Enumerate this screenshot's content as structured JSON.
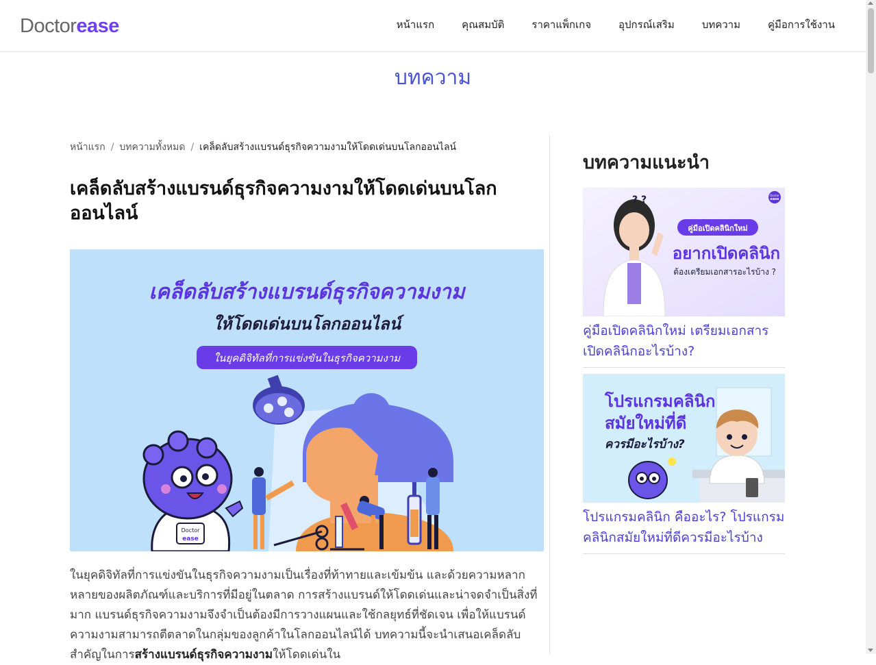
{
  "brand": {
    "logo_part1": "Doctor",
    "logo_part2": "ease"
  },
  "nav": [
    {
      "label": "หน้าแรก"
    },
    {
      "label": "คุณสมบัติ"
    },
    {
      "label": "ราคาแพ็กเกจ"
    },
    {
      "label": "อุปกรณ์เสริม"
    },
    {
      "label": "บทความ"
    },
    {
      "label": "คู่มือการใช้งาน"
    }
  ],
  "page_heading": "บทความ",
  "breadcrumb": {
    "home": "หน้าแรก",
    "all": "บทความทั้งหมด",
    "current": "เคล็ดลับสร้างแบรนด์ธุรกิจความงามให้โดดเด่นบนโลกออนไลน์"
  },
  "article": {
    "title": "เคล็ดลับสร้างแบรนด์ธุรกิจความงามให้โดดเด่นบนโลกออนไลน์",
    "hero": {
      "line1": "เคล็ดลับสร้างแบรนด์ธุรกิจความงาม",
      "line2": "ให้โดดเด่นบนโลกออนไลน์",
      "pill": "ในยุคดิจิทัลที่การแข่งขันในธุรกิจความงาม",
      "mascot_logo_top": "Doctor",
      "mascot_logo_bottom": "ease"
    },
    "body_pre": "ในยุคดิจิทัลที่การแข่งขันในธุรกิจความงามเป็นเรื่องที่ท้าทายและเข้มข้น และด้วยความหลากหลายของผลิตภัณฑ์และบริการที่มีอยู่ในตลาด การสร้างแบรนด์ให้โดดเด่นและน่าจดจำเป็นสิ่งที่มาก แบรนด์ธุรกิจความงามจึงจำเป็นต้องมีการวางแผนและใช้กลยุทธ์ที่ชัดเจน เพื่อให้แบรนด์ความงามสามารถตีตลาดในกลุ่มของลูกค้าในโลกออนไลน์ได้ บทความนี้จะนำเสนอเคล็ดลับสำคัญในการ",
    "body_bold": "สร้างแบรนด์ธุรกิจความงาม",
    "body_post": "ให้โดดเด่นใน"
  },
  "sidebar": {
    "title": "บทความแนะนำ",
    "cards": [
      {
        "title": "คู่มือเปิดคลินิกใหม่ เตรียมเอกสารเปิดคลินิกอะไรบ้าง?",
        "thumb": {
          "badge": "คู่มือเปิดคลินิกใหม่",
          "headline": "อยากเปิดคลินิก",
          "sub": "ต้องเตรียมเอกสารอะไรบ้าง ?",
          "marks": "? ?",
          "logo_top": "Doctor",
          "logo_bottom": "ease"
        }
      },
      {
        "title": "โปรแกรมคลินิก คืออะไร? โปรแกรมคลินิกสมัยใหม่ที่ดีควรมีอะไรบ้าง",
        "thumb": {
          "line1": "โปรแกรมคลินิก",
          "line2": "สมัยใหม่ที่ดี",
          "line3": "ควรมีอะไรบ้าง?"
        }
      }
    ]
  },
  "colors": {
    "brand_purple": "#6e3ff0",
    "link_purple": "#4a3fd6",
    "hero_bg": "#bfe0fa"
  }
}
